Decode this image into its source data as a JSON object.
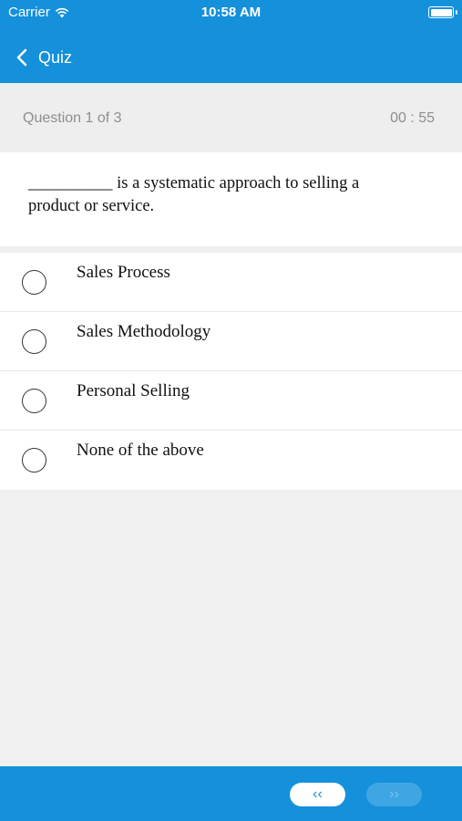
{
  "status_bar": {
    "carrier": "Carrier",
    "time": "10:58 AM",
    "icons": [
      "wifi-icon",
      "battery-icon"
    ]
  },
  "nav": {
    "back_label": "Quiz",
    "back_icon": "chevron-left-icon"
  },
  "question": {
    "counter": "Question 1 of 3",
    "timer": "00 : 55",
    "text": "__________ is a systematic approach to selling a product or service."
  },
  "options": [
    {
      "label": "Sales Process",
      "selected": false
    },
    {
      "label": "Sales Methodology",
      "selected": false
    },
    {
      "label": "Personal Selling",
      "selected": false
    },
    {
      "label": "None of the above",
      "selected": false
    }
  ],
  "footer": {
    "prev_label": "‹‹",
    "next_label": "››",
    "next_enabled": false
  },
  "colors": {
    "accent": "#1590db",
    "background": "#f0f0f0"
  }
}
